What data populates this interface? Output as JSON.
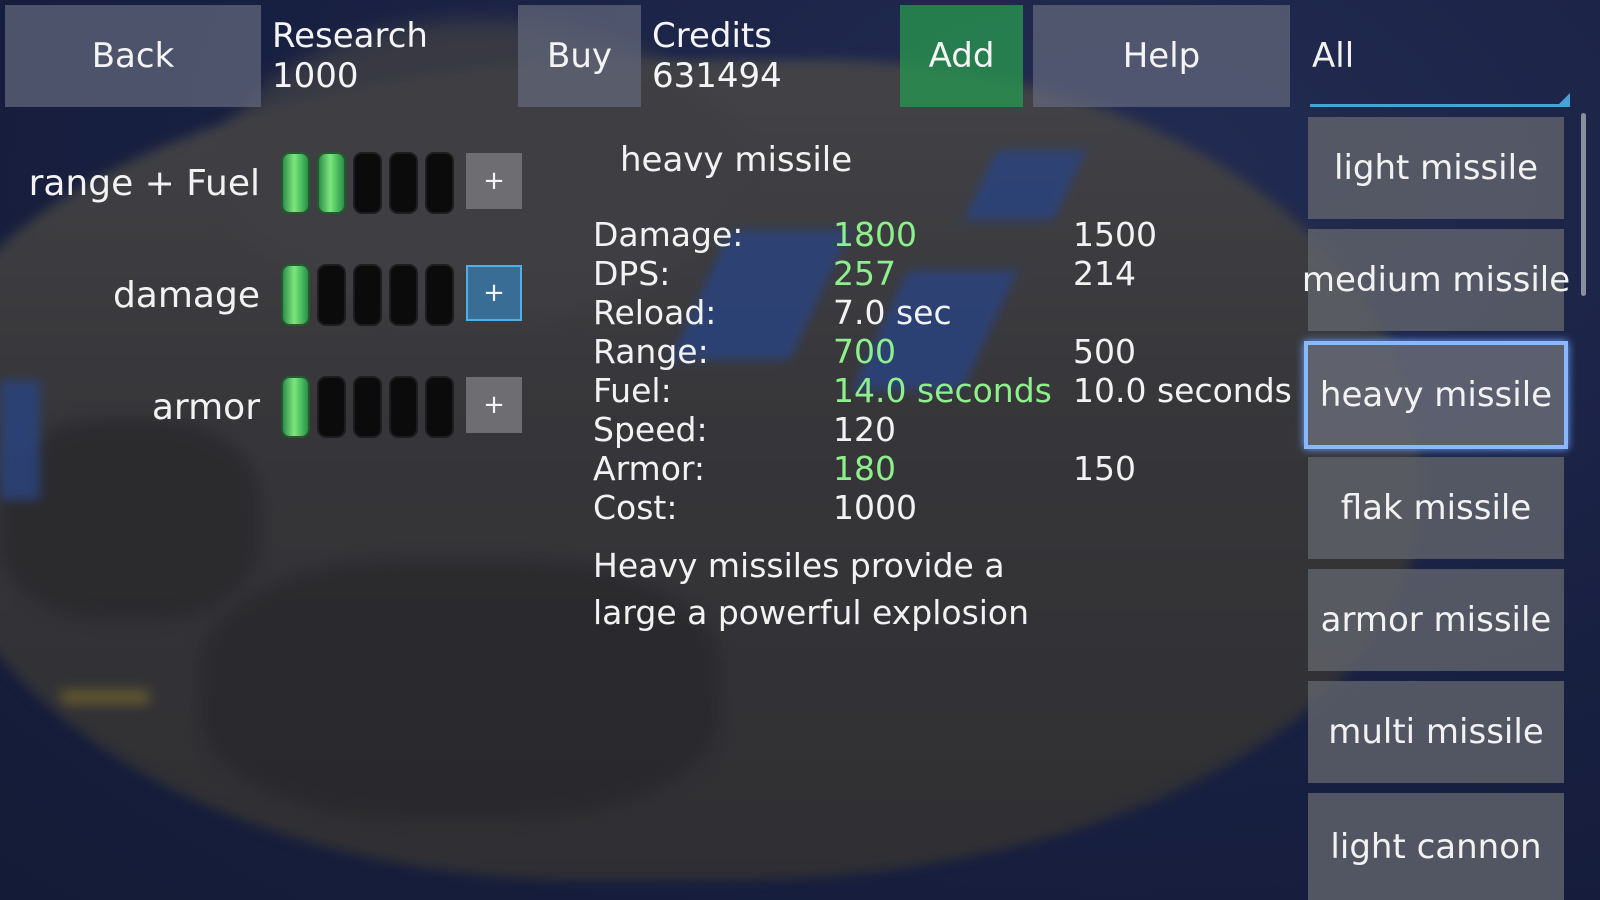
{
  "topbar": {
    "back_label": "Back",
    "research_label": "Research 1000",
    "buy_label": "Buy",
    "credits_label": "Credits 631494",
    "add_label": "Add",
    "help_label": "Help",
    "filter_value": "All"
  },
  "upgrades": [
    {
      "label": "range + Fuel",
      "level": 2,
      "max": 5
    },
    {
      "label": "damage",
      "level": 1,
      "max": 5
    },
    {
      "label": "armor",
      "level": 1,
      "max": 5
    }
  ],
  "plus_label": "+",
  "weapon": {
    "name": "heavy missile",
    "stats": [
      {
        "label": "Damage:",
        "value": "1800",
        "base": "1500",
        "improved": true
      },
      {
        "label": "DPS:",
        "value": "257",
        "base": "214",
        "improved": true
      },
      {
        "label": "Reload:",
        "value": "7.0 sec",
        "base": "",
        "improved": false
      },
      {
        "label": "Range:",
        "value": "700",
        "base": "500",
        "improved": true
      },
      {
        "label": "Fuel:",
        "value": "14.0 seconds",
        "base": "10.0 seconds",
        "improved": true
      },
      {
        "label": "Speed:",
        "value": "120",
        "base": "",
        "improved": false
      },
      {
        "label": "Armor:",
        "value": "180",
        "base": "150",
        "improved": true
      },
      {
        "label": "Cost:",
        "value": "1000",
        "base": "",
        "improved": false
      }
    ],
    "description_line1": "Heavy missiles provide a",
    "description_line2": "large a powerful explosion"
  },
  "weapon_list": [
    {
      "label": "light missile",
      "selected": false
    },
    {
      "label": "medium missile",
      "selected": false
    },
    {
      "label": "heavy missile",
      "selected": true
    },
    {
      "label": "flak missile",
      "selected": false
    },
    {
      "label": "armor missile",
      "selected": false
    },
    {
      "label": "multi missile",
      "selected": false
    },
    {
      "label": "light cannon",
      "selected": false
    }
  ],
  "colors": {
    "improved_value": "#8ef08c",
    "add_button": "#28964f",
    "selection_border": "#8ab8ff"
  }
}
